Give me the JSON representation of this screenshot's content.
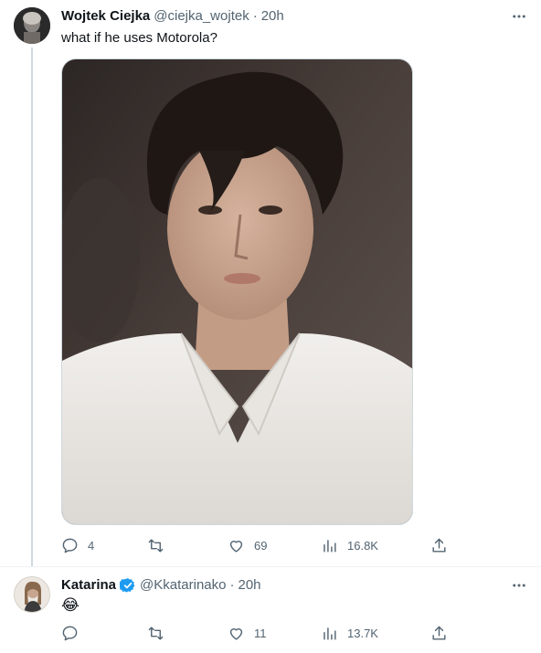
{
  "tweets": [
    {
      "display_name": "Wojtek Ciejka",
      "handle": "@ciejka_wojtek",
      "separator": "·",
      "time": "20h",
      "text": "what if he uses Motorola?",
      "verified": false,
      "has_media": true,
      "media_alt": "photo of a young man with dark tousled hair wearing a white shirt",
      "stats": {
        "replies": "4",
        "retweets": "",
        "likes": "69",
        "views": "16.8K"
      }
    },
    {
      "display_name": "Katarina",
      "handle": "@Kkatarinako",
      "separator": "·",
      "time": "20h",
      "text": "😂",
      "verified": true,
      "has_media": false,
      "stats": {
        "replies": "",
        "retweets": "",
        "likes": "11",
        "views": "13.7K"
      }
    }
  ],
  "icons": [
    "more-icon",
    "reply-icon",
    "retweet-icon",
    "like-icon",
    "views-icon",
    "share-icon",
    "verified-badge-icon"
  ],
  "colors": {
    "text": "#0f1419",
    "secondary": "#536471",
    "border": "#cfd9de",
    "verified": "#1d9bf0"
  }
}
